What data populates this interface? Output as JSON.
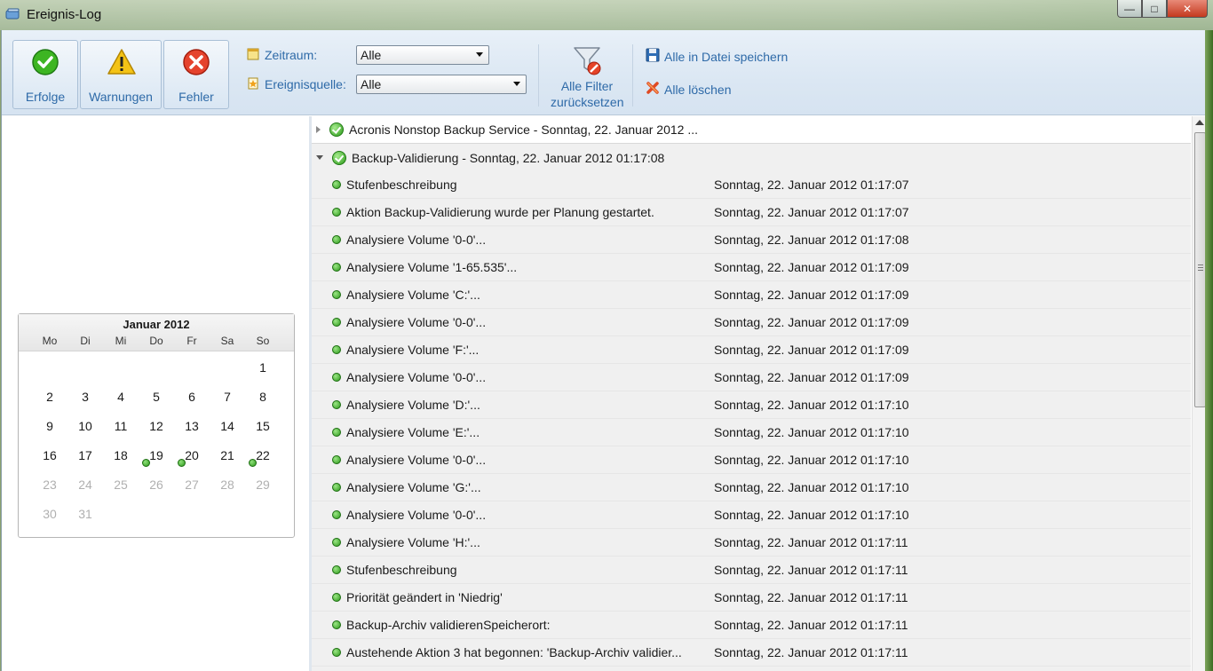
{
  "window": {
    "title": "Ereignis-Log"
  },
  "toolbar": {
    "success_label": "Erfolge",
    "warnings_label": "Warnungen",
    "errors_label": "Fehler",
    "period_label": "Zeitraum:",
    "period_value": "Alle",
    "source_label": "Ereignisquelle:",
    "source_value": "Alle",
    "reset_filters_label": "Alle Filter zurücksetzen",
    "save_all_label": "Alle in Datei speichern",
    "delete_all_label": "Alle löschen"
  },
  "calendar": {
    "title": "Januar 2012",
    "weekdays": [
      "Mo",
      "Di",
      "Mi",
      "Do",
      "Fr",
      "Sa",
      "So"
    ],
    "weeks": [
      [
        "",
        "",
        "",
        "",
        "",
        "",
        "1"
      ],
      [
        "2",
        "3",
        "4",
        "5",
        "6",
        "7",
        "8"
      ],
      [
        "9",
        "10",
        "11",
        "12",
        "13",
        "14",
        "15"
      ],
      [
        "16",
        "17",
        "18",
        "19",
        "20",
        "21",
        "22"
      ],
      [
        "23",
        "24",
        "25",
        "26",
        "27",
        "28",
        "29"
      ],
      [
        "30",
        "31",
        "",
        "",
        "",
        "",
        ""
      ]
    ],
    "marked_days": [
      "19",
      "20",
      "22"
    ]
  },
  "log": {
    "collapsed_group": "Acronis Nonstop Backup Service - Sonntag, 22. Januar 2012 ...",
    "expanded_group": "Backup-Validierung - Sonntag, 22. Januar 2012 01:17:08",
    "rows": [
      {
        "msg": "Stufenbeschreibung",
        "time": "Sonntag, 22. Januar 2012 01:17:07"
      },
      {
        "msg": "Aktion Backup-Validierung wurde per Planung gestartet.",
        "time": "Sonntag, 22. Januar 2012 01:17:07"
      },
      {
        "msg": "Analysiere Volume '0-0'...",
        "time": "Sonntag, 22. Januar 2012 01:17:08"
      },
      {
        "msg": "Analysiere Volume '1-65.535'...",
        "time": "Sonntag, 22. Januar 2012 01:17:09"
      },
      {
        "msg": "Analysiere Volume 'C:'...",
        "time": "Sonntag, 22. Januar 2012 01:17:09"
      },
      {
        "msg": "Analysiere Volume '0-0'...",
        "time": "Sonntag, 22. Januar 2012 01:17:09"
      },
      {
        "msg": "Analysiere Volume 'F:'...",
        "time": "Sonntag, 22. Januar 2012 01:17:09"
      },
      {
        "msg": "Analysiere Volume '0-0'...",
        "time": "Sonntag, 22. Januar 2012 01:17:09"
      },
      {
        "msg": "Analysiere Volume 'D:'...",
        "time": "Sonntag, 22. Januar 2012 01:17:10"
      },
      {
        "msg": "Analysiere Volume 'E:'...",
        "time": "Sonntag, 22. Januar 2012 01:17:10"
      },
      {
        "msg": "Analysiere Volume '0-0'...",
        "time": "Sonntag, 22. Januar 2012 01:17:10"
      },
      {
        "msg": "Analysiere Volume 'G:'...",
        "time": "Sonntag, 22. Januar 2012 01:17:10"
      },
      {
        "msg": "Analysiere Volume '0-0'...",
        "time": "Sonntag, 22. Januar 2012 01:17:10"
      },
      {
        "msg": "Analysiere Volume 'H:'...",
        "time": "Sonntag, 22. Januar 2012 01:17:11"
      },
      {
        "msg": "Stufenbeschreibung",
        "time": "Sonntag, 22. Januar 2012 01:17:11"
      },
      {
        "msg": "Priorität geändert in 'Niedrig'",
        "time": "Sonntag, 22. Januar 2012 01:17:11"
      },
      {
        "msg": "Backup-Archiv validierenSpeicherort:",
        "time": "Sonntag, 22. Januar 2012 01:17:11"
      },
      {
        "msg": "Austehende Aktion 3 hat begonnen: 'Backup-Archiv validier...",
        "time": "Sonntag, 22. Januar 2012 01:17:11"
      }
    ]
  },
  "icons": {
    "success": "check-circle-icon",
    "warning": "warning-triangle-icon",
    "error": "error-x-circle-icon",
    "period": "calendar-icon",
    "source": "star-document-icon",
    "reset": "funnel-clear-icon",
    "save": "floppy-disk-icon",
    "delete": "red-x-icon"
  },
  "colors": {
    "accent_text": "#2e6aa8",
    "success": "#2e9a1c"
  }
}
